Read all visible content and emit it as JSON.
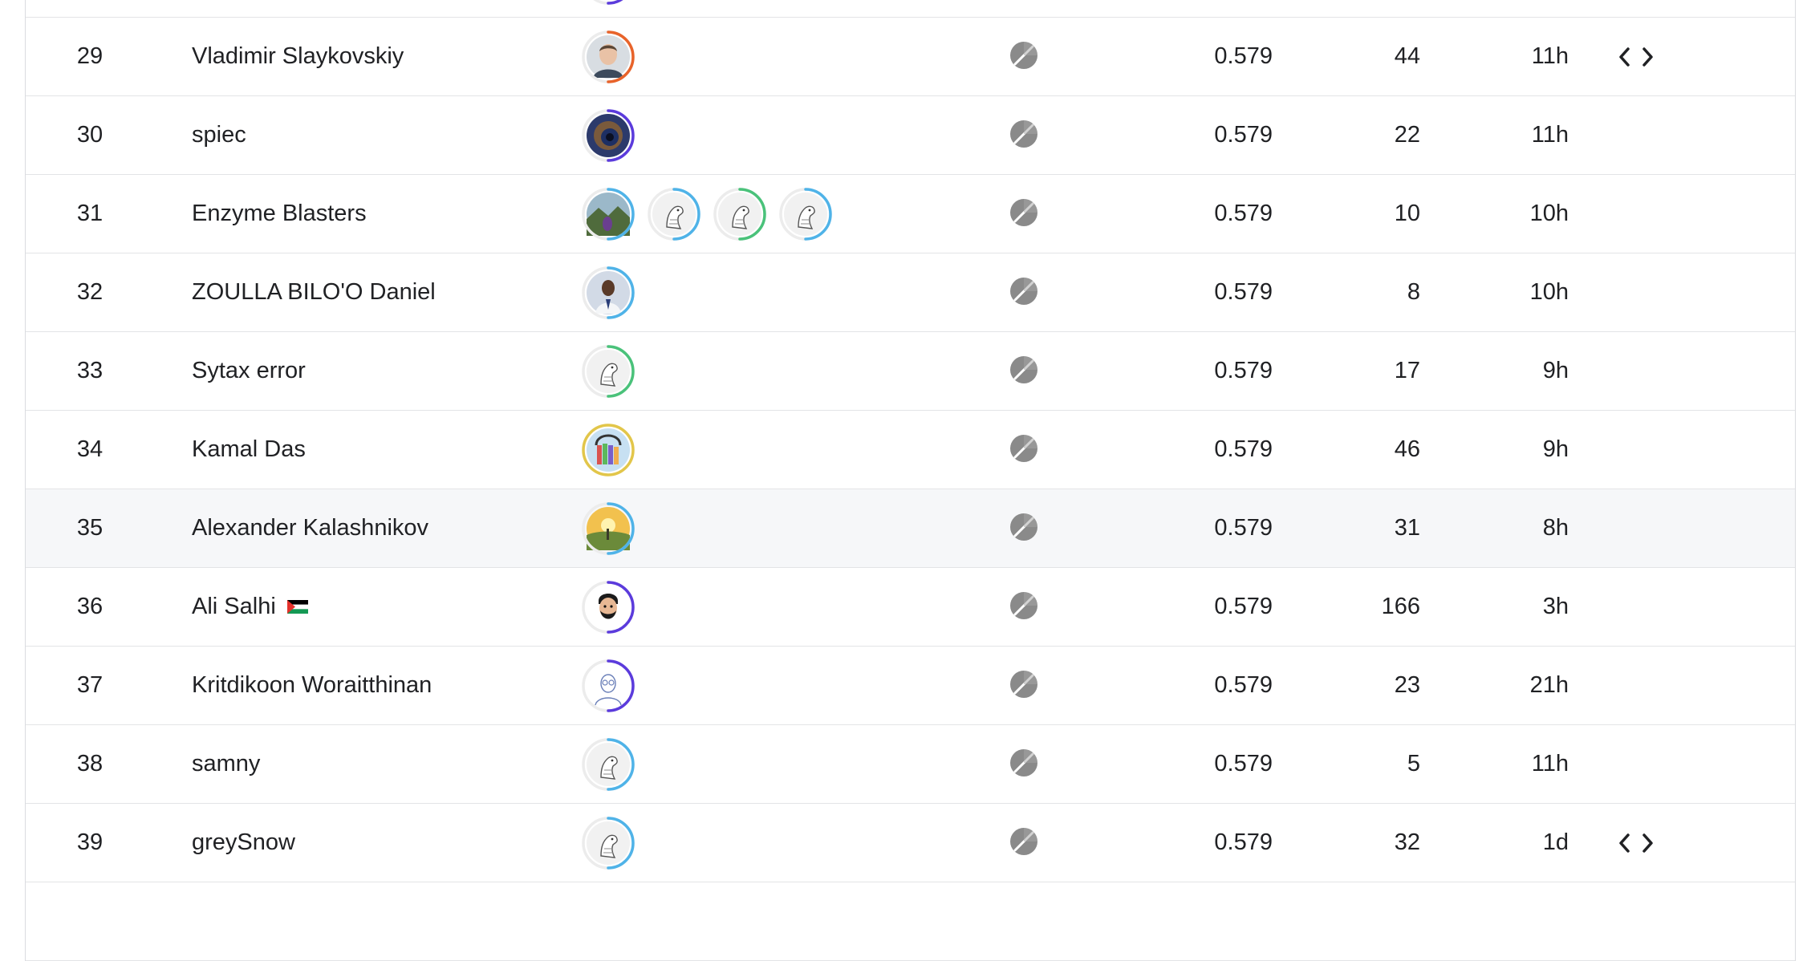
{
  "leaderboard": {
    "rows": [
      {
        "rank": "",
        "team": "",
        "score": "",
        "entries": "",
        "last": "",
        "code": false,
        "avatars": [
          {
            "kind": "default",
            "ring": "#5b3bdc"
          }
        ],
        "highlight": false
      },
      {
        "rank": "29",
        "team": "Vladimir Slaykovskiy",
        "score": "0.579",
        "entries": "44",
        "last": "11h",
        "code": true,
        "avatars": [
          {
            "kind": "man-photo",
            "ring": "#e8632a"
          }
        ],
        "highlight": false
      },
      {
        "rank": "30",
        "team": "spiec",
        "score": "0.579",
        "entries": "22",
        "last": "11h",
        "code": false,
        "avatars": [
          {
            "kind": "eye-photo",
            "ring": "#5b3bdc"
          }
        ],
        "highlight": false
      },
      {
        "rank": "31",
        "team": "Enzyme Blasters",
        "score": "0.579",
        "entries": "10",
        "last": "10h",
        "code": false,
        "avatars": [
          {
            "kind": "landscape-photo",
            "ring": "#4fb3e8"
          },
          {
            "kind": "default",
            "ring": "#4fb3e8"
          },
          {
            "kind": "default",
            "ring": "#4ac27a"
          },
          {
            "kind": "default",
            "ring": "#4fb3e8"
          }
        ],
        "highlight": false
      },
      {
        "rank": "32",
        "team": "ZOULLA BILO'O Daniel",
        "score": "0.579",
        "entries": "8",
        "last": "10h",
        "code": false,
        "avatars": [
          {
            "kind": "person-photo",
            "ring": "#4fb3e8"
          }
        ],
        "highlight": false
      },
      {
        "rank": "33",
        "team": "Sytax error",
        "score": "0.579",
        "entries": "17",
        "last": "9h",
        "code": false,
        "avatars": [
          {
            "kind": "default",
            "ring": "#4ac27a"
          }
        ],
        "highlight": false
      },
      {
        "rank": "34",
        "team": "Kamal Das",
        "score": "0.579",
        "entries": "46",
        "last": "9h",
        "code": false,
        "avatars": [
          {
            "kind": "books-photo",
            "ring": "#e2c64a"
          }
        ],
        "highlight": false
      },
      {
        "rank": "35",
        "team": "Alexander Kalashnikov",
        "score": "0.579",
        "entries": "31",
        "last": "8h",
        "code": false,
        "avatars": [
          {
            "kind": "sunset-photo",
            "ring": "#4fb3e8"
          }
        ],
        "highlight": true
      },
      {
        "rank": "36",
        "team": "Ali Salhi",
        "score": "0.579",
        "entries": "166",
        "last": "3h",
        "code": false,
        "flag": "palestine-flag",
        "avatars": [
          {
            "kind": "cartoon-face",
            "ring": "#5b3bdc"
          }
        ],
        "highlight": false
      },
      {
        "rank": "37",
        "team": "Kritdikoon Woraitthinan",
        "score": "0.579",
        "entries": "23",
        "last": "21h",
        "code": false,
        "avatars": [
          {
            "kind": "sketch-face",
            "ring": "#5b3bdc"
          }
        ],
        "highlight": false
      },
      {
        "rank": "38",
        "team": "samny",
        "score": "0.579",
        "entries": "5",
        "last": "11h",
        "code": false,
        "avatars": [
          {
            "kind": "default",
            "ring": "#4fb3e8"
          }
        ],
        "highlight": false
      },
      {
        "rank": "39",
        "team": "greySnow",
        "score": "0.579",
        "entries": "32",
        "last": "1d",
        "code": true,
        "avatars": [
          {
            "kind": "default",
            "ring": "#4fb3e8"
          }
        ],
        "highlight": false
      },
      {
        "rank": "",
        "team": "",
        "score": "",
        "entries": "",
        "last": "",
        "code": false,
        "avatars": [],
        "highlight": false
      }
    ],
    "icons": {
      "medal": "no-medal-icon",
      "code": "code-icon"
    },
    "colors": {
      "medal": "#8a8a8a",
      "border": "#e3e4e6",
      "highlight_bg": "#f6f7f9"
    }
  }
}
